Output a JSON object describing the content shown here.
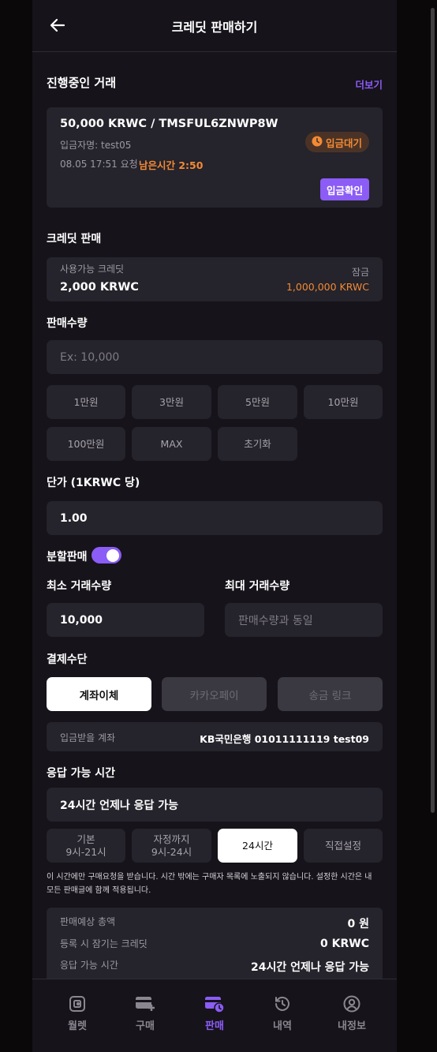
{
  "header": {
    "title": "크레딧 판매하기"
  },
  "ongoing": {
    "title": "진행중인 거래",
    "more_label": "더보기",
    "trade": {
      "headline": "50,000 KRWC / TMSFUL6ZNWP8W",
      "depositor": "입금자명: test05",
      "requested": "08.05 17:51 요청",
      "remaining": "남은시간 2:50",
      "status": "입금대기",
      "confirm_label": "입금확인"
    }
  },
  "credit": {
    "title": "크레딧 판매",
    "available_label": "사용가능 크레딧",
    "available_value": "2,000 KRWC",
    "locked_label": "잠금",
    "locked_value": "1,000,000 KRWC"
  },
  "quantity": {
    "title": "판매수량",
    "placeholder": "Ex: 10,000",
    "chips": [
      "1만원",
      "3만원",
      "5만원",
      "10만원",
      "100만원",
      "MAX",
      "초기화"
    ]
  },
  "price": {
    "title": "단가 (1KRWC 당)",
    "value": "1.00"
  },
  "split": {
    "label": "분할판매",
    "enabled": true,
    "min_label": "최소 거래수량",
    "min_value": "10,000",
    "max_label": "최대 거래수량",
    "max_placeholder": "판매수량과 동일"
  },
  "payment": {
    "title": "결제수단",
    "methods": [
      "계좌이체",
      "카카오페이",
      "송금 링크"
    ],
    "account_label": "입금받을 계좌",
    "account_value": "KB국민은행 01011111119 test09"
  },
  "response": {
    "title": "응답 가능 시간",
    "current": "24시간 언제나 응답 가능",
    "options": [
      {
        "line1": "기본",
        "line2": "9시-21시"
      },
      {
        "line1": "자정까지",
        "line2": "9시-24시"
      },
      {
        "line1": "24시간",
        "line2": ""
      },
      {
        "line1": "직접설정",
        "line2": ""
      }
    ],
    "note_line1": "이 시간에만 구매요청을 받습니다. 시간 밖에는 구매자 목록에 노출되지 않습니다. 설정한 시간은 내",
    "note_line2": "모든 판매글에 함께 적용됩니다."
  },
  "summary": {
    "rows": [
      {
        "label": "판매예상 총액",
        "value": "0 원"
      },
      {
        "label": "등록 시 잠기는 크레딧",
        "value": "0 KRWC"
      },
      {
        "label": "응답 가능 시간",
        "value": "24시간 언제나 응답 가능"
      }
    ]
  },
  "nav": {
    "items": [
      {
        "label": "월렛",
        "icon": "wallet-icon"
      },
      {
        "label": "구매",
        "icon": "buy-card-icon"
      },
      {
        "label": "판매",
        "icon": "sell-card-icon",
        "active": true
      },
      {
        "label": "내역",
        "icon": "history-icon"
      },
      {
        "label": "내정보",
        "icon": "profile-icon"
      }
    ]
  },
  "colors": {
    "accent": "#8b5cf6",
    "orange": "#f28a35",
    "background": "#16131a",
    "surface": "#25232b"
  }
}
